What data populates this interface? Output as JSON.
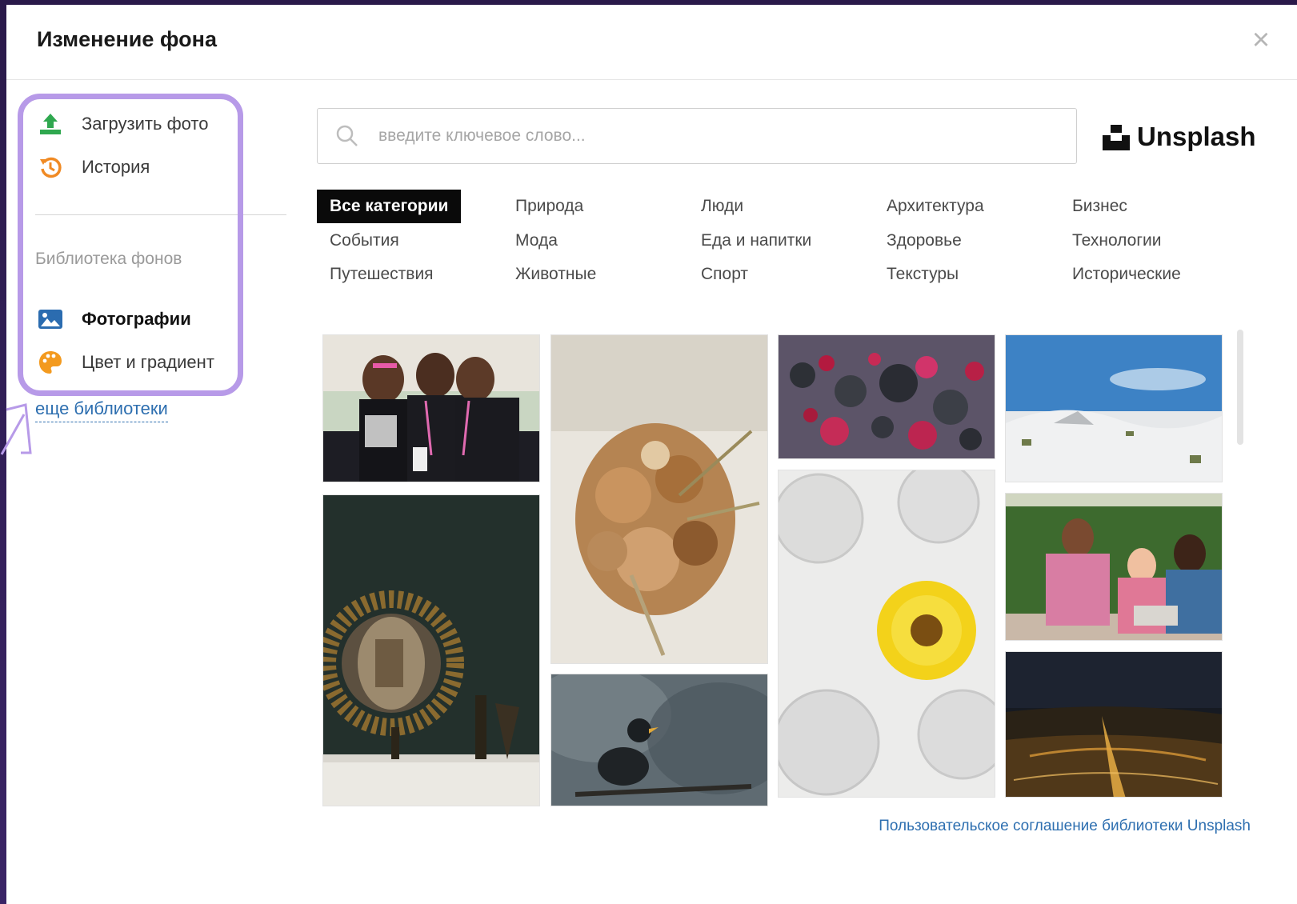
{
  "dialog": {
    "title": "Изменение фона",
    "close_icon": "close-icon"
  },
  "sidebar": {
    "items": [
      {
        "label": "Загрузить фото",
        "icon": "upload-icon"
      },
      {
        "label": "История",
        "icon": "history-icon"
      }
    ],
    "section_title": "Библиотека фонов",
    "library_items": [
      {
        "label": "Фотографии",
        "icon": "image-icon",
        "selected": true
      },
      {
        "label": "Цвет и градиент",
        "icon": "palette-icon",
        "selected": false
      }
    ],
    "more_link": "еще библиотеки",
    "highlight_color": "#b79ae8"
  },
  "search": {
    "value": "",
    "placeholder": "введите ключевое слово...",
    "brand": "Unsplash"
  },
  "categories": [
    {
      "label": "Все категории",
      "active": true
    },
    {
      "label": "Природа"
    },
    {
      "label": "Люди"
    },
    {
      "label": "Архитектура"
    },
    {
      "label": "Бизнес"
    },
    {
      "label": "События"
    },
    {
      "label": "Мода"
    },
    {
      "label": "Еда и напитки"
    },
    {
      "label": "Здоровье"
    },
    {
      "label": "Технологии"
    },
    {
      "label": "Путешествия"
    },
    {
      "label": "Животные"
    },
    {
      "label": "Спорт"
    },
    {
      "label": "Текстуры"
    },
    {
      "label": "Исторические"
    }
  ],
  "photos": [
    {
      "subject": "women-walk-event-photo"
    },
    {
      "subject": "dried-flower-bouquet-photo"
    },
    {
      "subject": "abstract-spheres-photo"
    },
    {
      "subject": "white-sand-dunes-photo"
    },
    {
      "subject": "sunburst-mirror-interior-photo"
    },
    {
      "subject": "bird-on-branch-photo"
    },
    {
      "subject": "yellow-flower-glasses-photo"
    },
    {
      "subject": "friends-laughing-photo"
    },
    {
      "subject": "city-night-lights-photo"
    }
  ],
  "footer": {
    "link": "Пользовательское соглашение библиотеки Unsplash"
  },
  "colors": {
    "link": "#2e6fb0",
    "active_category_bg": "#0a0a0a",
    "upload_icon": "#2fa84f",
    "history_icon": "#f08a24",
    "image_icon": "#2b6cb0",
    "palette_icon": "#f39a1f"
  }
}
